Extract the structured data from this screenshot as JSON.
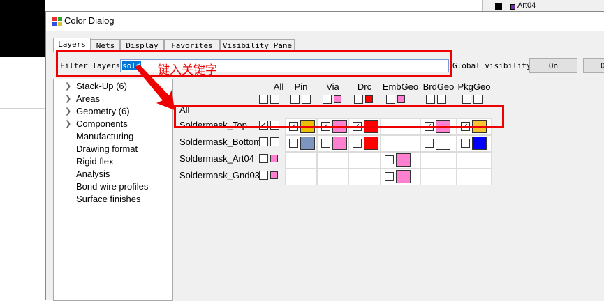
{
  "background": {
    "top_right_text": "Art04",
    "top_right_swatch_color": "#7030a0"
  },
  "dialog": {
    "title": "Color Dialog",
    "tabs": [
      "Layers",
      "Nets",
      "Display",
      "Favorites",
      "Visibility Pane"
    ],
    "active_tab": "Layers",
    "filter_label": "Filter layers:",
    "filter_value": "sold",
    "annotation": "键入关键字",
    "global_visibility_label": "Global visibility:",
    "on_button": "On",
    "off_button_partial": "O"
  },
  "tree": {
    "items": [
      {
        "label": "Stack-Up (6)",
        "expandable": true
      },
      {
        "label": "Areas",
        "expandable": true
      },
      {
        "label": "Geometry (6)",
        "expandable": true
      },
      {
        "label": "Components",
        "expandable": true
      },
      {
        "label": "Manufacturing",
        "expandable": false
      },
      {
        "label": "Drawing format",
        "expandable": false
      },
      {
        "label": "Rigid flex",
        "expandable": false
      },
      {
        "label": "Analysis",
        "expandable": false
      },
      {
        "label": "Bond wire profiles",
        "expandable": false
      },
      {
        "label": "Surface finishes",
        "expandable": false
      }
    ]
  },
  "grid": {
    "columns": [
      "All",
      "Pin",
      "Via",
      "Drc",
      "EmbGeo",
      "BrdGeo",
      "PkgGeo"
    ],
    "all_row_label": "All",
    "header_swatches": {
      "Via": "#ff7fd0",
      "Drc": "#ff0000",
      "EmbGeo": "#ff7fd0"
    },
    "rows": [
      {
        "name": "Soldermask_Top",
        "all_checked": true,
        "cells": {
          "Pin": {
            "checked": true,
            "color": "#ecc000"
          },
          "Via": {
            "checked": true,
            "color": "#ff7fd0"
          },
          "Drc": {
            "checked": true,
            "color": "#ff0000"
          },
          "BrdGeo": {
            "checked": true,
            "color": "#ff7fd0"
          },
          "PkgGeo": {
            "checked": true,
            "color": "#f8c430"
          }
        }
      },
      {
        "name": "Soldermask_Bottom",
        "all_checked": false,
        "cells": {
          "Pin": {
            "checked": false,
            "color": "#7c96c0"
          },
          "Via": {
            "checked": false,
            "color": "#ff7fd0"
          },
          "Drc": {
            "checked": false,
            "color": "#ff0000"
          },
          "BrdGeo": {
            "checked": false,
            "color": "#ffffff"
          },
          "PkgGeo": {
            "checked": false,
            "color": "#0000ff"
          }
        }
      },
      {
        "name": "Soldermask_Art04",
        "all_checked": false,
        "all_swatch": "#ff7fd0",
        "cells": {
          "EmbGeo": {
            "checked": false,
            "color": "#ff7fd0"
          }
        }
      },
      {
        "name": "Soldermask_Gnd03",
        "all_checked": false,
        "all_swatch": "#ff7fd0",
        "cells": {
          "EmbGeo": {
            "checked": false,
            "color": "#ff7fd0"
          }
        }
      }
    ]
  }
}
